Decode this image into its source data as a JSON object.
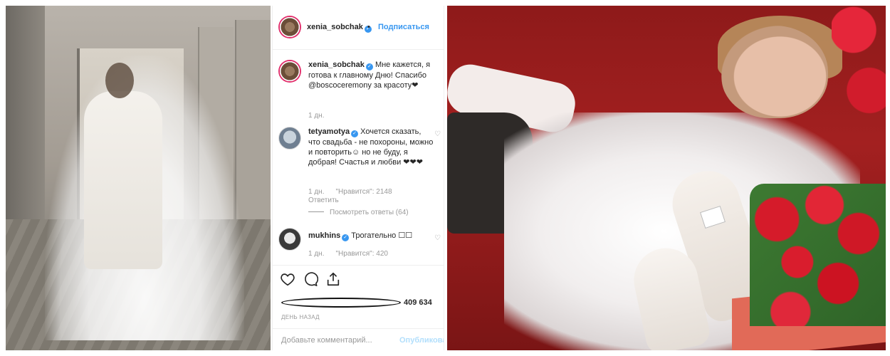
{
  "post": {
    "username": "xenia_sobchak",
    "follow_label": "Подписаться",
    "caption_text": "Мне кажется, я готова к главному Дню! Спасибо @boscoceremony за красоту❤",
    "caption_time": "1 дн.",
    "likes_count": "409 634",
    "time_ago": "ДЕНЬ НАЗАД",
    "comment_placeholder": "Добавьте комментарий...",
    "publish_label": "Опубликовать"
  },
  "comments": [
    {
      "username": "tetyamotya",
      "text": "Хочется сказать, что свадьба - не похороны, можно и повторить☺ но не буду, я добрая! Счастья и любви ❤❤❤",
      "time": "1 дн.",
      "likes": "\"Нравится\": 2148",
      "reply": "Ответить",
      "view_replies": "Посмотреть ответы (64)"
    },
    {
      "username": "mukhins",
      "text": "Трогательно ☐☐",
      "time": "1 дн.",
      "likes": "\"Нравится\": 420"
    }
  ],
  "colors": {
    "link_blue": "#3897f0",
    "muted": "#999999",
    "text": "#262626"
  },
  "icons": [
    "verified-badge-icon",
    "heart-icon",
    "comment-icon",
    "share-icon"
  ]
}
